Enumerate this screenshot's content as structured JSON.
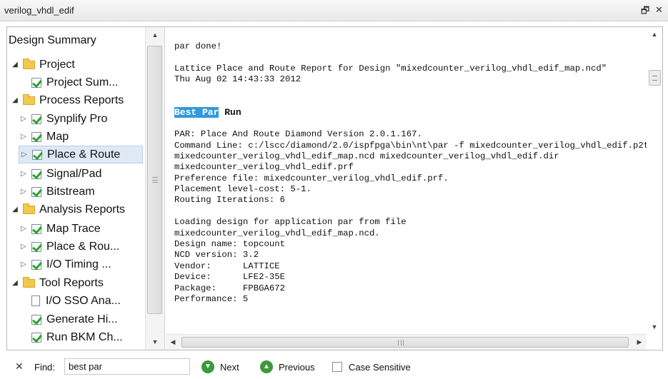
{
  "window": {
    "title": "verilog_vhdl_edif",
    "restore_symbol": "🗗",
    "close_symbol": "✕"
  },
  "tree": {
    "header": "Design Summary",
    "items": [
      {
        "label": "Project",
        "icon": "folder-icon",
        "expanded": true
      },
      {
        "label": "Project Sum...",
        "icon": "check-icon"
      },
      {
        "label": "Process Reports",
        "icon": "folder-icon",
        "expanded": true
      },
      {
        "label": "Synplify Pro",
        "icon": "check-icon",
        "expandable": true
      },
      {
        "label": "Map",
        "icon": "check-icon",
        "expandable": true
      },
      {
        "label": "Place & Route",
        "icon": "check-icon",
        "expandable": true,
        "selected": true
      },
      {
        "label": "Signal/Pad",
        "icon": "check-icon",
        "expandable": true
      },
      {
        "label": "Bitstream",
        "icon": "check-icon",
        "expandable": true
      },
      {
        "label": "Analysis Reports",
        "icon": "folder-icon",
        "expanded": true
      },
      {
        "label": "Map Trace",
        "icon": "check-icon",
        "expandable": true
      },
      {
        "label": "Place & Rou...",
        "icon": "check-icon",
        "expandable": true
      },
      {
        "label": "I/O Timing ...",
        "icon": "check-icon",
        "expandable": true
      },
      {
        "label": "Tool Reports",
        "icon": "folder-icon",
        "expanded": true
      },
      {
        "label": "I/O SSO Ana...",
        "icon": "document-icon"
      },
      {
        "label": "Generate Hi...",
        "icon": "check-icon"
      },
      {
        "label": "Run BKM Ch...",
        "icon": "check-icon"
      }
    ]
  },
  "report": {
    "lines": [
      "par done!",
      "",
      "Lattice Place and Route Report for Design \"mixedcounter_verilog_vhdl_edif_map.ncd\"",
      "Thu Aug 02 14:43:33 2012",
      "",
      "",
      "",
      "",
      "PAR: Place And Route Diamond Version 2.0.1.167.",
      "Command Line: c:/lscc/diamond/2.0/ispfpga\\bin\\nt\\par -f mixedcounter_verilog_vhdl_edif.p2t",
      "mixedcounter_verilog_vhdl_edif_map.ncd mixedcounter_verilog_vhdl_edif.dir",
      "mixedcounter_verilog_vhdl_edif.prf",
      "Preference file: mixedcounter_verilog_vhdl_edif.prf.",
      "Placement level-cost: 5-1.",
      "Routing Iterations: 6",
      "",
      "Loading design for application par from file",
      "mixedcounter_verilog_vhdl_edif_map.ncd.",
      "Design name: topcount",
      "NCD version: 3.2",
      "Vendor:      LATTICE",
      "Device:      LFE2-35E",
      "Package:     FPBGA672",
      "Performance: 5"
    ],
    "heading_highlight": "Best Par",
    "heading_rest": " Run"
  },
  "find": {
    "close": "✕",
    "label": "Find:",
    "value": "best par",
    "next_label": "Next",
    "previous_label": "Previous",
    "case_sensitive_label": "Case Sensitive",
    "case_sensitive": false
  },
  "colors": {
    "highlight": "#3399d8",
    "selection": "#dfe9f5",
    "nav_button": "#3a9a3a"
  }
}
